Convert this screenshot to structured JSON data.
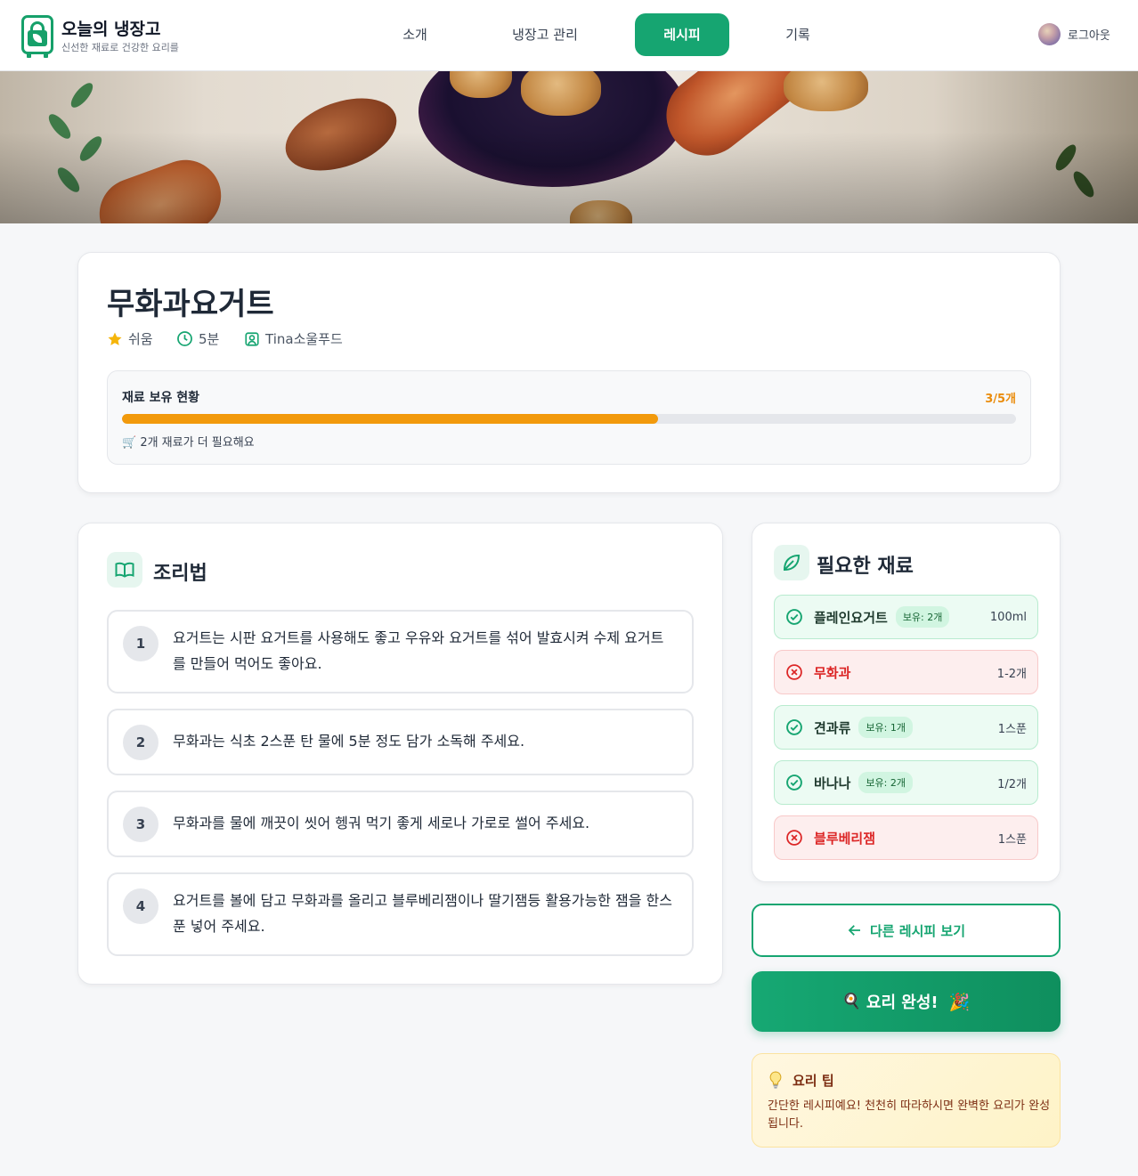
{
  "brand": {
    "title": "오늘의 냉장고",
    "subtitle": "신선한 재료로 건강한 요리를"
  },
  "nav": {
    "items": [
      "소개",
      "냉장고 관리",
      "레시피",
      "기록"
    ],
    "active": "레시피"
  },
  "user": {
    "logout_label": "로그아웃"
  },
  "recipe": {
    "title": "무화과요거트",
    "difficulty": "쉬움",
    "time": "5분",
    "author": "Tina소울푸드"
  },
  "stock": {
    "label": "재료 보유 현황",
    "count": "3/5개",
    "owned": 3,
    "total": 5,
    "note": "🛒 2개 재료가 더 필요해요"
  },
  "instructions": {
    "title": "조리법",
    "steps": [
      {
        "num": "1",
        "text": "요거트는 시판 요거트를 사용해도 좋고 우유와 요거트를 섞어 발효시켜 수제 요거트를 만들어 먹어도 좋아요."
      },
      {
        "num": "2",
        "text": "무화과는 식초 2스푼 탄 물에 5분 정도 담가 소독해 주세요."
      },
      {
        "num": "3",
        "text": "무화과를 물에 깨끗이 씻어 헹궈 먹기 좋게 세로나 가로로 썰어 주세요."
      },
      {
        "num": "4",
        "text": "요거트를 볼에 담고 무화과를 올리고 블루베리잼이나 딸기잼등 활용가능한 잼을 한스푼 넣어 주세요."
      }
    ]
  },
  "ingredients": {
    "title": "필요한 재료",
    "items": [
      {
        "name": "플레인요거트",
        "have": true,
        "badge": "보유: 2개",
        "amount": "100ml"
      },
      {
        "name": "무화과",
        "have": false,
        "badge": "",
        "amount": "1-2개"
      },
      {
        "name": "견과류",
        "have": true,
        "badge": "보유: 1개",
        "amount": "1스푼"
      },
      {
        "name": "바나나",
        "have": true,
        "badge": "보유: 2개",
        "amount": "1/2개"
      },
      {
        "name": "블루베리잼",
        "have": false,
        "badge": "",
        "amount": "1스푼"
      }
    ]
  },
  "actions": {
    "back_label": "다른 레시피 보기",
    "done_label": "요리 완성!",
    "done_prefix_emoji": "🍳",
    "done_suffix_emoji": "🎉"
  },
  "tip": {
    "title": "요리 팁",
    "text": "간단한 레시피예요! 천천히 따라하시면 완벽한 요리가 완성됩니다."
  },
  "colors": {
    "primary": "#16a571",
    "progress": "#f29a0c",
    "missing": "#dc2626",
    "star": "#f5b50a"
  }
}
